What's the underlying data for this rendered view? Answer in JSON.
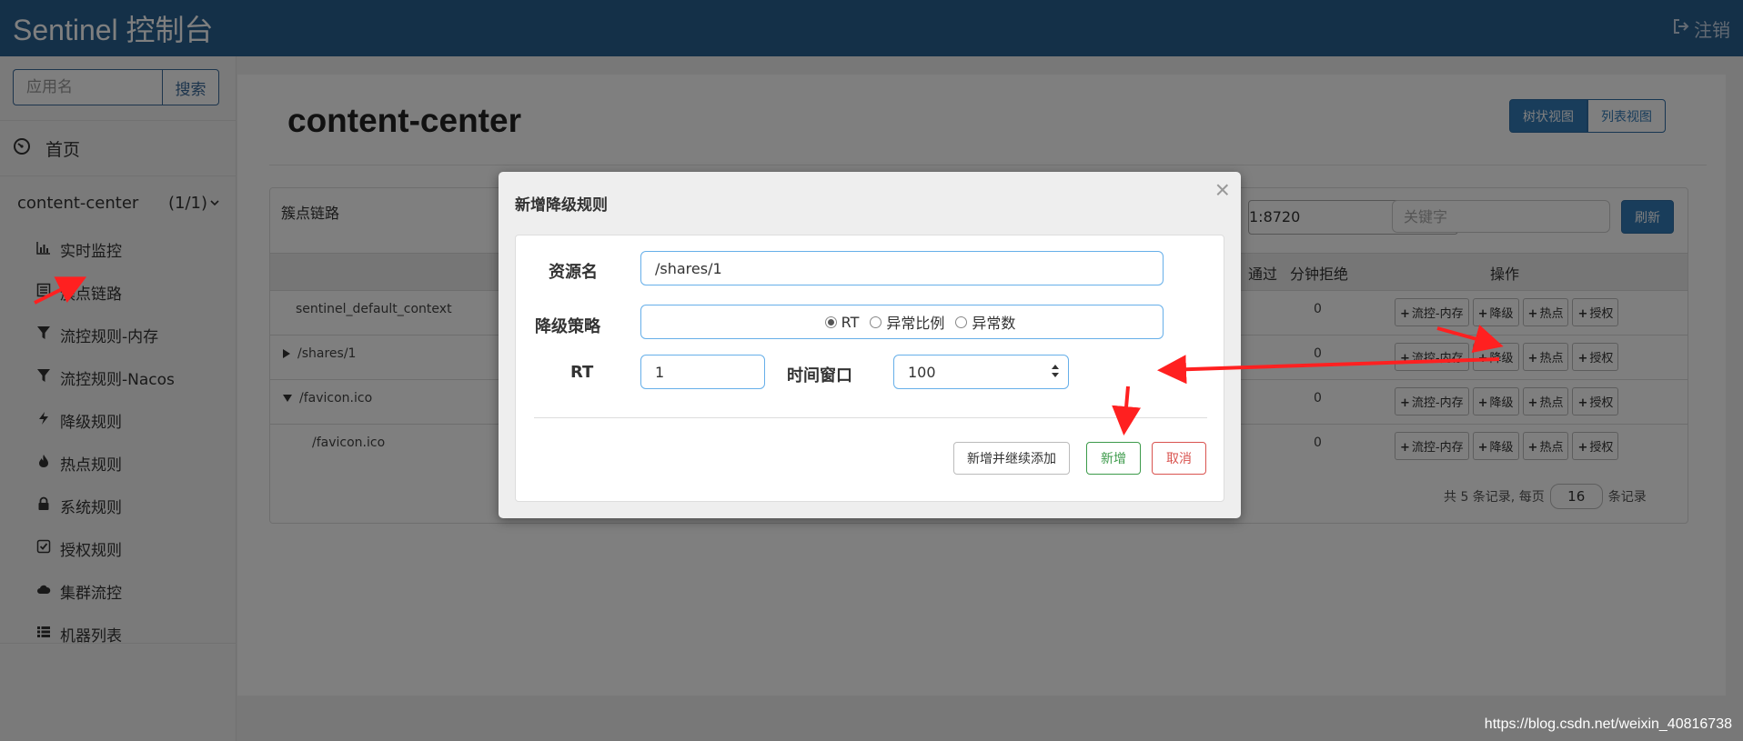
{
  "header": {
    "brand": "Sentinel 控制台",
    "logout_label": "注销"
  },
  "sidebar": {
    "search": {
      "placeholder": "应用名",
      "button_label": "搜索"
    },
    "home_label": "首页",
    "app": {
      "name": "content-center",
      "count": "(1/1)"
    },
    "items": [
      {
        "label": "实时监控",
        "icon": "bar-chart-icon"
      },
      {
        "label": "簇点链路",
        "icon": "list-alt-icon"
      },
      {
        "label": "流控规则-内存",
        "icon": "filter-icon"
      },
      {
        "label": "流控规则-Nacos",
        "icon": "filter-icon"
      },
      {
        "label": "降级规则",
        "icon": "flash-icon"
      },
      {
        "label": "热点规则",
        "icon": "fire-icon"
      },
      {
        "label": "系统规则",
        "icon": "lock-icon"
      },
      {
        "label": "授权规则",
        "icon": "check-icon"
      },
      {
        "label": "集群流控",
        "icon": "cloud-icon"
      },
      {
        "label": "机器列表",
        "icon": "th-list-icon"
      }
    ]
  },
  "main": {
    "title": "content-center",
    "view_tree": "树状视图",
    "view_list": "列表视图",
    "panel_title": "簇点链路",
    "machine_value": "1:8720",
    "keyword_placeholder": "关键字",
    "refresh_label": "刷新",
    "columns": {
      "pass_fragment": "通过",
      "minute_reject": "分钟拒绝",
      "ops": "操作"
    },
    "rows": [
      {
        "resource": "sentinel_default_context",
        "reject": "0"
      },
      {
        "resource": "/shares/1",
        "reject": "0"
      },
      {
        "resource": "/favicon.ico",
        "reject": "0"
      },
      {
        "resource": "/favicon.ico",
        "reject": "0"
      }
    ],
    "ops_buttons": {
      "flow": "流控-内存",
      "degrade": "降级",
      "hot": "热点",
      "auth": "授权"
    },
    "pager": {
      "prefix": "共 5 条记录, 每页",
      "page_size": "16",
      "suffix": "条记录"
    }
  },
  "modal": {
    "title": "新增降级规则",
    "close": "×",
    "resource_label": "资源名",
    "resource_value": "/shares/1",
    "strategy_label": "降级策略",
    "strategy_options": [
      "RT",
      "异常比例",
      "异常数"
    ],
    "strategy_selected": "RT",
    "rt_label": "RT",
    "rt_value": "1",
    "window_label": "时间窗口",
    "window_value": "100",
    "btn_continue": "新增并继续添加",
    "btn_add": "新增",
    "btn_cancel": "取消"
  },
  "colors": {
    "header": "#286090",
    "primary": "#337ab7",
    "success": "#3c9a4a",
    "danger": "#d9534f",
    "arrow": "#ff2020"
  },
  "watermark": "https://blog.csdn.net/weixin_40816738"
}
